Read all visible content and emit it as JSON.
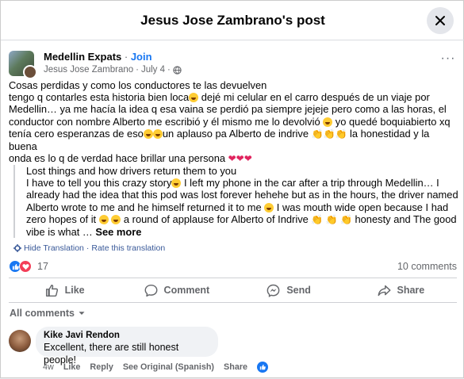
{
  "modal": {
    "title": "Jesus Jose Zambrano's post"
  },
  "post": {
    "group_name": "Medellin Expats",
    "join_label": "Join",
    "author": "Jesus Jose Zambrano",
    "date": "July 4",
    "text_line1": "Cosas perdidas y como los conductores te las devuelven",
    "text_line2a": "tengo q contarles esta historia bien loca",
    "text_line2b": " dejé mi celular en el carro después de un viaje por",
    "text_line3": "Medellin… ya me hacía la idea q esa vaina se perdió pa siempre jejeje pero como a las horas, el",
    "text_line4a": "conductor con nombre Alberto me escribió y él mismo me lo devolvió ",
    "text_line4b": " yo quedé boquiabierto xq",
    "text_line5a": "tenía cero esperanzas de eso",
    "text_line5b": "un aplauso pa Alberto de indrive ",
    "text_line5c": " la honestidad y la buena",
    "text_line6": "onda es lo q de verdad hace brillar una persona ",
    "translation_line1": "Lost things and how drivers return them to you",
    "translation_line2a": "I have to tell you this crazy story",
    "translation_line2b": " I left my phone in the car after a trip through Medellin… I",
    "translation_line3": "already had the idea that this pod was lost forever hehehe but as in the hours, the driver named",
    "translation_line4a": "Alberto wrote to me and he himself returned it to me ",
    "translation_line4b": " I was mouth wide open because I had",
    "translation_line5a": "zero hopes of it ",
    "translation_line5b": " a round of applause for Alberto of Indrive ",
    "translation_line5c": " honesty and The good",
    "translation_line6": "vibe is what … ",
    "see_more": "See more",
    "hide_translation": "Hide Translation",
    "rate_translation": "Rate this translation"
  },
  "reactions": {
    "count": "17",
    "comments": "10 comments"
  },
  "actions": {
    "like": "Like",
    "comment": "Comment",
    "send": "Send",
    "share": "Share"
  },
  "comments_filter": "All comments",
  "comment": {
    "author": "Kike Javi Rendon",
    "text": "Excellent, there are still honest people!",
    "time": "4w",
    "like": "Like",
    "reply": "Reply",
    "see_original": "See Original (Spanish)",
    "share": "Share"
  },
  "colors": {
    "accent": "#1877f2",
    "love": "#f33e58",
    "muted": "#65676b"
  }
}
